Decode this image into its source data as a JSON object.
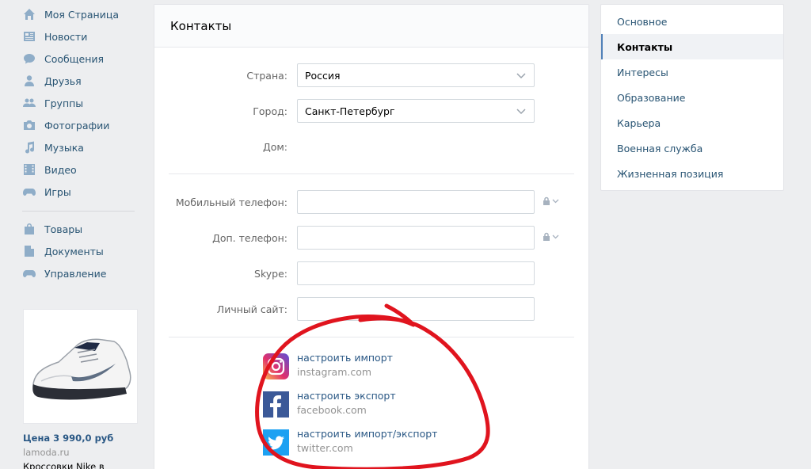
{
  "nav": {
    "items": [
      {
        "label": "Моя Страница",
        "icon": "home-icon"
      },
      {
        "label": "Новости",
        "icon": "news-icon"
      },
      {
        "label": "Сообщения",
        "icon": "messages-icon"
      },
      {
        "label": "Друзья",
        "icon": "friends-icon"
      },
      {
        "label": "Группы",
        "icon": "groups-icon"
      },
      {
        "label": "Фотографии",
        "icon": "camera-icon"
      },
      {
        "label": "Музыка",
        "icon": "music-icon"
      },
      {
        "label": "Видео",
        "icon": "video-icon"
      },
      {
        "label": "Игры",
        "icon": "gamepad-icon"
      }
    ],
    "items2": [
      {
        "label": "Товары",
        "icon": "bag-icon"
      },
      {
        "label": "Документы",
        "icon": "document-icon"
      },
      {
        "label": "Управление",
        "icon": "gamepad-icon"
      }
    ]
  },
  "ad": {
    "price": "Цена 3 990,0 руб",
    "domain": "lamoda.ru",
    "title": "Кроссовки Nike в"
  },
  "main": {
    "title": "Контакты",
    "country": {
      "label": "Страна:",
      "value": "Россия"
    },
    "city": {
      "label": "Город:",
      "value": "Санкт-Петербург"
    },
    "house": {
      "label": "Дом:"
    },
    "mobile": {
      "label": "Мобильный телефон:",
      "value": ""
    },
    "extra_phone": {
      "label": "Доп. телефон:",
      "value": ""
    },
    "skype": {
      "label": "Skype:",
      "value": ""
    },
    "site": {
      "label": "Личный сайт:",
      "value": ""
    },
    "social": [
      {
        "action": "настроить импорт",
        "domain": "instagram.com",
        "icon": "instagram-icon"
      },
      {
        "action": "настроить экспорт",
        "domain": "facebook.com",
        "icon": "facebook-icon"
      },
      {
        "action": "настроить импорт/экспорт",
        "domain": "twitter.com",
        "icon": "twitter-icon"
      }
    ]
  },
  "right_menu": {
    "items": [
      "Основное",
      "Контакты",
      "Интересы",
      "Образование",
      "Карьера",
      "Военная служба",
      "Жизненная позиция"
    ],
    "active": "Контакты"
  },
  "colors": {
    "link": "#2a5885",
    "nav_text": "#285473",
    "nav_icon": "#8fadc8",
    "active_border": "#5181b8",
    "annotation_red": "#e0141e"
  }
}
